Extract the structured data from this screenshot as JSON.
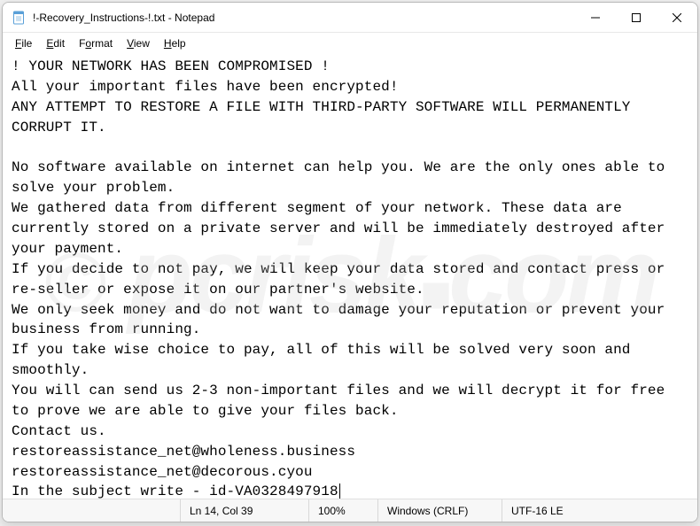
{
  "titlebar": {
    "title": "!-Recovery_Instructions-!.txt - Notepad"
  },
  "menu": {
    "file": "File",
    "edit": "Edit",
    "format": "Format",
    "view": "View",
    "help": "Help"
  },
  "content": {
    "body": "! YOUR NETWORK HAS BEEN COMPROMISED !\nAll your important files have been encrypted!\nANY ATTEMPT TO RESTORE A FILE WITH THIRD-PARTY SOFTWARE WILL PERMANENTLY CORRUPT IT.\n\nNo software available on internet can help you. We are the only ones able to solve your problem.\nWe gathered data from different segment of your network. These data are currently stored on a private server and will be immediately destroyed after your payment.\nIf you decide to not pay, we will keep your data stored and contact press or re-seller or expose it on our partner's website.\nWe only seek money and do not want to damage your reputation or prevent your business from running.\nIf you take wise choice to pay, all of this will be solved very soon and smoothly.\nYou will can send us 2-3 non-important files and we will decrypt it for free to prove we are able to give your files back.\nContact us.\nrestoreassistance_net@wholeness.business\nrestoreassistance_net@decorous.cyou\nIn the subject write - id-VA0328497918"
  },
  "statusbar": {
    "position": "Ln 14, Col 39",
    "zoom": "100%",
    "eol": "Windows (CRLF)",
    "encoding": "UTF-16 LE"
  },
  "watermark": {
    "text": "pcrisk.com"
  }
}
